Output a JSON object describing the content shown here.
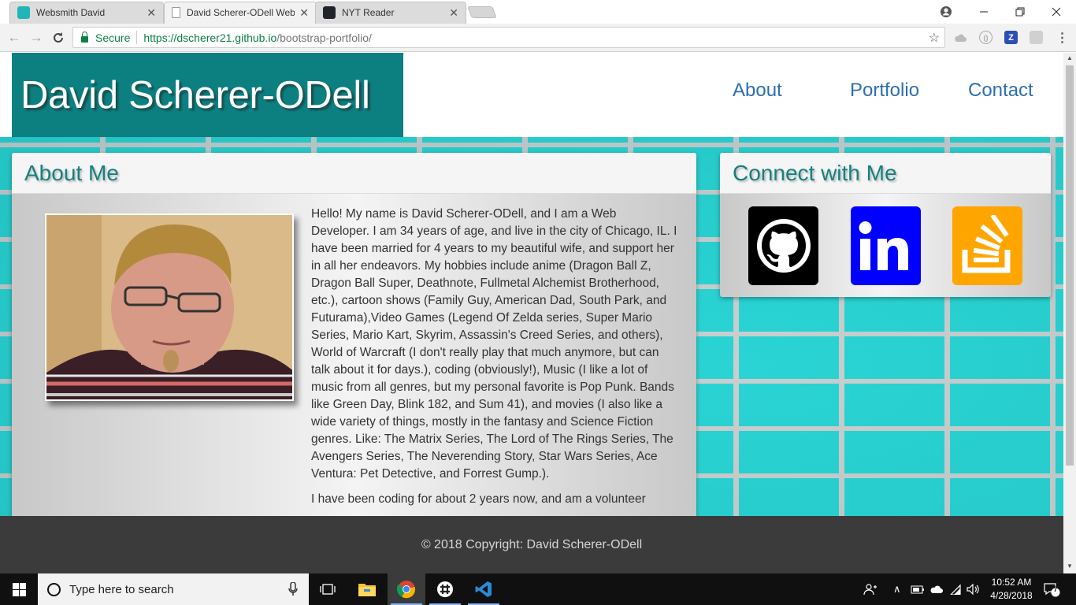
{
  "browser": {
    "tabs": [
      {
        "label": "Websmith David",
        "active": false
      },
      {
        "label": "David Scherer-ODell Web",
        "active": true
      },
      {
        "label": "NYT Reader",
        "active": false
      }
    ],
    "secure_label": "Secure",
    "url_host": "https://dscherer21.github.io",
    "url_path": "/bootstrap-portfolio/"
  },
  "site": {
    "brand": "David Scherer-ODell",
    "nav": [
      "About",
      "Portfolio",
      "Contact"
    ],
    "about": {
      "heading": "About Me",
      "paragraphs": [
        "Hello! My name is David Scherer-ODell, and I am a Web Developer. I am 34 years of age, and live in the city of Chicago, IL. I have been married for 4 years to my beautiful wife, and support her in all her endeavors. My hobbies include anime (Dragon Ball Z, Dragon Ball Super, Deathnote, Fullmetal Alchemist Brotherhood, etc.), cartoon shows (Family Guy, American Dad, South Park, and Futurama),Video Games (Legend Of Zelda series, Super Mario Series, Mario Kart, Skyrim, Assassin's Creed Series, and others), World of Warcraft (I don't really play that much anymore, but can talk about it for days.), coding (obviously!), Music (I like a lot of music from all genres, but my personal favorite is Pop Punk. Bands like Green Day, Blink 182, and Sum 41), and movies (I also like a wide variety of things, mostly in the fantasy and Science Fiction genres. Like: The Matrix Series, The Lord of The Rings Series, The Avengers Series, The Neverending Story, Star Wars Series, Ace Ventura: Pet Detective, and Forrest Gump.).",
        "I have been coding for about 2 years now, and am a volunteer"
      ]
    },
    "connect": {
      "heading": "Connect with Me",
      "links": [
        {
          "name": "GitHub",
          "color": "#000000",
          "icon": "github-icon"
        },
        {
          "name": "LinkedIn",
          "color": "#0000ff",
          "icon": "linkedin-icon"
        },
        {
          "name": "Stack Overflow",
          "color": "#ffa500",
          "icon": "stackoverflow-icon"
        }
      ]
    },
    "footer": "© 2018 Copyright: David Scherer-ODell"
  },
  "taskbar": {
    "search_placeholder": "Type here to search",
    "time": "10:52 AM",
    "date": "4/28/2018",
    "notification_count": "7"
  },
  "colors": {
    "brand_bg": "#0c7f80",
    "heading": "#17807f",
    "nav_link": "#2d6fb0",
    "footer_bg": "#3b3b3b",
    "brick": "#2ad4d4"
  }
}
